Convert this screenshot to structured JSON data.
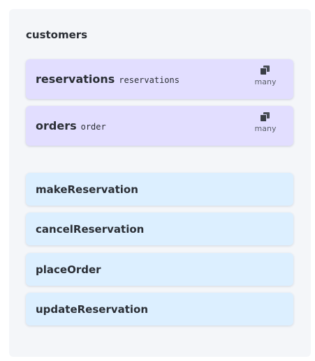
{
  "entity": {
    "title": "customers"
  },
  "relations": [
    {
      "name": "reservations",
      "target": "reservations",
      "cardinality": "many",
      "icon": "copy-icon"
    },
    {
      "name": "orders",
      "target": "order",
      "cardinality": "many",
      "icon": "copy-icon"
    }
  ],
  "methods": [
    {
      "name": "makeReservation"
    },
    {
      "name": "cancelReservation"
    },
    {
      "name": "placeOrder"
    },
    {
      "name": "updateReservation"
    }
  ],
  "colors": {
    "panel_bg": "#f4f6f9",
    "relation_bg": "#e2deff",
    "method_bg": "#dcefff",
    "text": "#2b2f36"
  }
}
